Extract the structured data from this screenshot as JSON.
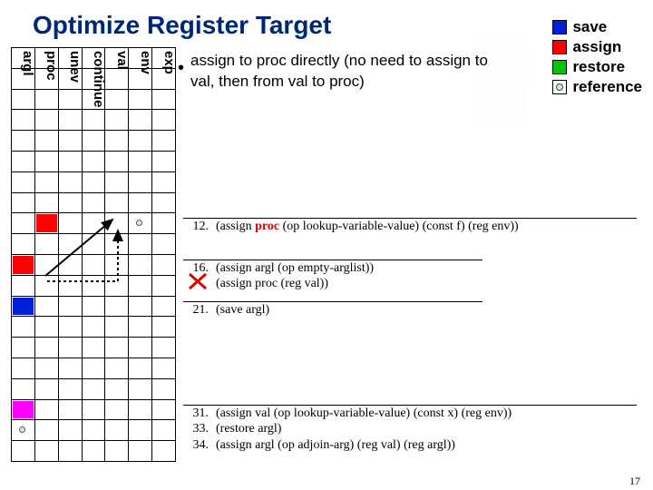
{
  "title": "Optimize Register Target",
  "legend": {
    "save": "save",
    "assign": "assign",
    "restore": "restore",
    "reference": "reference"
  },
  "registers": [
    "exp",
    "env",
    "val",
    "continue",
    "unev",
    "proc",
    "argl"
  ],
  "bullet": "assign to proc directly (no need to assign to val, then from val to proc)",
  "instructions": {
    "i12": {
      "num": "12.",
      "pre": "(assign ",
      "hl": "proc",
      "post": "    (op lookup-variable-value) (const f) (reg env))"
    },
    "i16": {
      "num": "16.",
      "code": "(assign argl (op empty-arglist))"
    },
    "iX": {
      "num": "X",
      "code": "(assign proc (reg val))"
    },
    "i21": {
      "num": "21.",
      "code": "(save argl)"
    },
    "i31": {
      "num": "31.",
      "code": "(assign val (op lookup-variable-value) (const x) (reg env))"
    },
    "i33": {
      "num": "33.",
      "code": "(restore argl)"
    },
    "i34": {
      "num": "34.",
      "code": "(assign argl (op adjoin-arg) (reg val) (reg argl))"
    }
  },
  "page": "17"
}
